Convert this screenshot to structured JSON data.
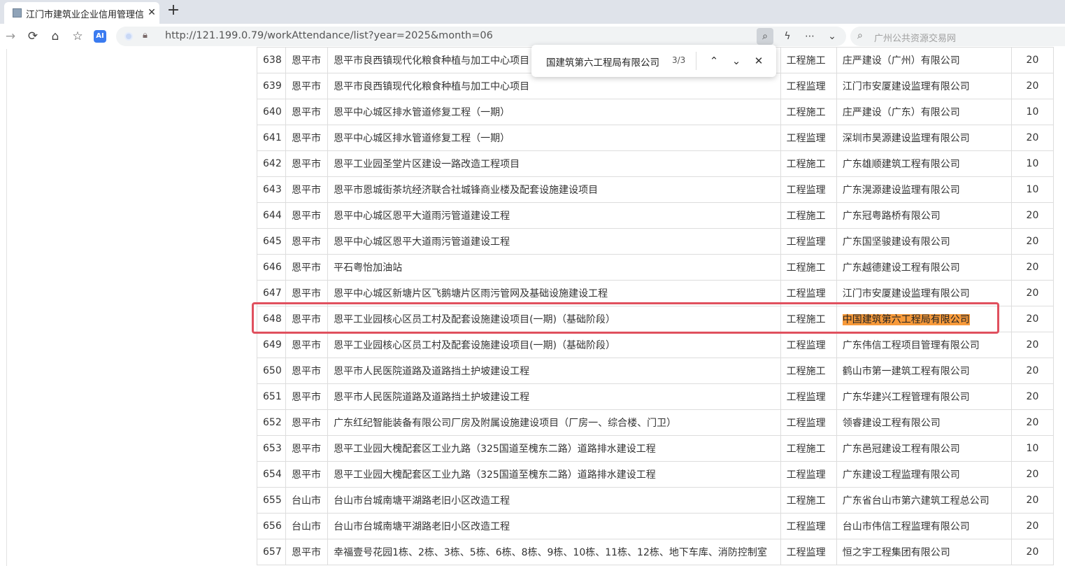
{
  "tab": {
    "title": "江门市建筑业企业信用管理信息",
    "close": "✕",
    "favicon": "page-icon"
  },
  "new_tab": "+",
  "toolbar": {
    "back": "→",
    "reload": "⟳",
    "home": "⌂",
    "favorites": "☆",
    "ai": "AI"
  },
  "url": "http://121.199.0.79/workAttendance/list?year=2025&month=06",
  "url_icons": {
    "find": "⌕",
    "bolt": "ϟ",
    "more": "⋯",
    "dropdown": "⌄"
  },
  "search": {
    "placeholder": "广州公共资源交易网",
    "icon": "⌕"
  },
  "find": {
    "query": "国建筑第六工程局有限公司",
    "count": "3/3",
    "prev": "⌃",
    "next": "⌄",
    "close": "✕"
  },
  "rows": [
    {
      "no": "638",
      "city": "恩平市",
      "project": "恩平市良西镇现代化粮食种植与加工中心项目",
      "type": "工程施工",
      "company": "庄严建设（广州）有限公司",
      "score": "20"
    },
    {
      "no": "639",
      "city": "恩平市",
      "project": "恩平市良西镇现代化粮食种植与加工中心项目",
      "type": "工程监理",
      "company": "江门市安厦建设监理有限公司",
      "score": "20"
    },
    {
      "no": "640",
      "city": "恩平市",
      "project": "恩平中心城区排水管道修复工程（一期）",
      "type": "工程施工",
      "company": "庄严建设（广东）有限公司",
      "score": "10"
    },
    {
      "no": "641",
      "city": "恩平市",
      "project": "恩平中心城区排水管道修复工程（一期）",
      "type": "工程监理",
      "company": "深圳市昊源建设监理有限公司",
      "score": "20"
    },
    {
      "no": "642",
      "city": "恩平市",
      "project": "恩平工业园圣堂片区建设一路改造工程项目",
      "type": "工程施工",
      "company": "广东雄顺建筑工程有限公司",
      "score": "10"
    },
    {
      "no": "643",
      "city": "恩平市",
      "project": "恩平市恩城街茶坑经济联合社城锋商业楼及配套设施建设项目",
      "type": "工程监理",
      "company": "广东滉源建设监理有限公司",
      "score": "10"
    },
    {
      "no": "644",
      "city": "恩平市",
      "project": "恩平中心城区恩平大道雨污管道建设工程",
      "type": "工程施工",
      "company": "广东冠粤路桥有限公司",
      "score": "20"
    },
    {
      "no": "645",
      "city": "恩平市",
      "project": "恩平中心城区恩平大道雨污管道建设工程",
      "type": "工程监理",
      "company": "广东国坚骏建设有限公司",
      "score": "20"
    },
    {
      "no": "646",
      "city": "恩平市",
      "project": "平石粤怡加油站",
      "type": "工程施工",
      "company": "广东越德建设工程有限公司",
      "score": "20"
    },
    {
      "no": "647",
      "city": "恩平市",
      "project": "恩平中心城区新塘片区飞鹅塘片区雨污管网及基础设施建设工程",
      "type": "工程监理",
      "company": "江门市安厦建设监理有限公司",
      "score": "20"
    },
    {
      "no": "648",
      "city": "恩平市",
      "project": "恩平工业园核心区员工村及配套设施建设项目(一期)（基础阶段）",
      "type": "工程施工",
      "company": "中国建筑第六工程局有限公司",
      "score": "20"
    },
    {
      "no": "649",
      "city": "恩平市",
      "project": "恩平工业园核心区员工村及配套设施建设项目(一期)（基础阶段）",
      "type": "工程监理",
      "company": "广东伟信工程项目管理有限公司",
      "score": "20"
    },
    {
      "no": "650",
      "city": "恩平市",
      "project": "恩平市人民医院道路及道路挡土护坡建设工程",
      "type": "工程施工",
      "company": "鹤山市第一建筑工程有限公司",
      "score": "20"
    },
    {
      "no": "651",
      "city": "恩平市",
      "project": "恩平市人民医院道路及道路挡土护坡建设工程",
      "type": "工程监理",
      "company": "广东华建兴工程管理有限公司",
      "score": "20"
    },
    {
      "no": "652",
      "city": "恩平市",
      "project": "广东红纪智能装备有限公司厂房及附属设施建设项目（厂房一、综合楼、门卫）",
      "type": "工程监理",
      "company": "领睿建设工程有限公司",
      "score": "20"
    },
    {
      "no": "653",
      "city": "恩平市",
      "project": "恩平工业园大槐配套区工业九路（325国道至槐东二路）道路排水建设工程",
      "type": "工程施工",
      "company": "广东邑冠建设工程有限公司",
      "score": "10"
    },
    {
      "no": "654",
      "city": "恩平市",
      "project": "恩平工业园大槐配套区工业九路（325国道至槐东二路）道路排水建设工程",
      "type": "工程监理",
      "company": "广东建设工程监理有限公司",
      "score": "20"
    },
    {
      "no": "655",
      "city": "台山市",
      "project": "台山市台城南塘平湖路老旧小区改造工程",
      "type": "工程施工",
      "company": "广东省台山市第六建筑工程总公司",
      "score": "20"
    },
    {
      "no": "656",
      "city": "台山市",
      "project": "台山市台城南塘平湖路老旧小区改造工程",
      "type": "工程监理",
      "company": "台山市伟信工程监理有限公司",
      "score": "20"
    },
    {
      "no": "657",
      "city": "恩平市",
      "project": "幸福壹号花园1栋、2栋、3栋、5栋、6栋、8栋、9栋、10栋、11栋、12栋、地下车库、消防控制室",
      "type": "工程监理",
      "company": "恒之宇工程集团有限公司",
      "score": "20"
    }
  ],
  "highlight": {
    "row": "648",
    "color": "#f79a3a",
    "box_color": "#e0505e"
  }
}
